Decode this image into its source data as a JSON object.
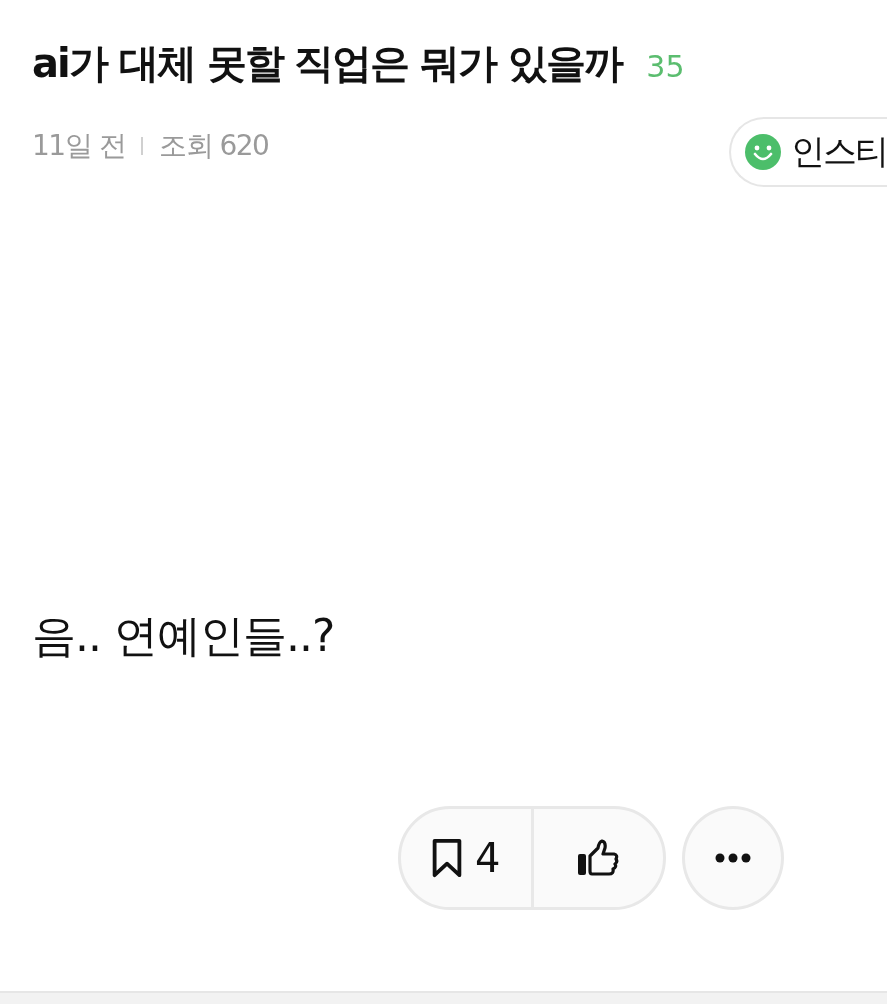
{
  "post": {
    "title": "ai가 대체 못할 직업은 뭐가 있을까",
    "comment_count": "35",
    "time": "11일 전",
    "views": "조회 620"
  },
  "author_chip": {
    "name": "인스티"
  },
  "body": "음.. 연예인들..?",
  "actions": {
    "bookmark_count": "4"
  }
}
